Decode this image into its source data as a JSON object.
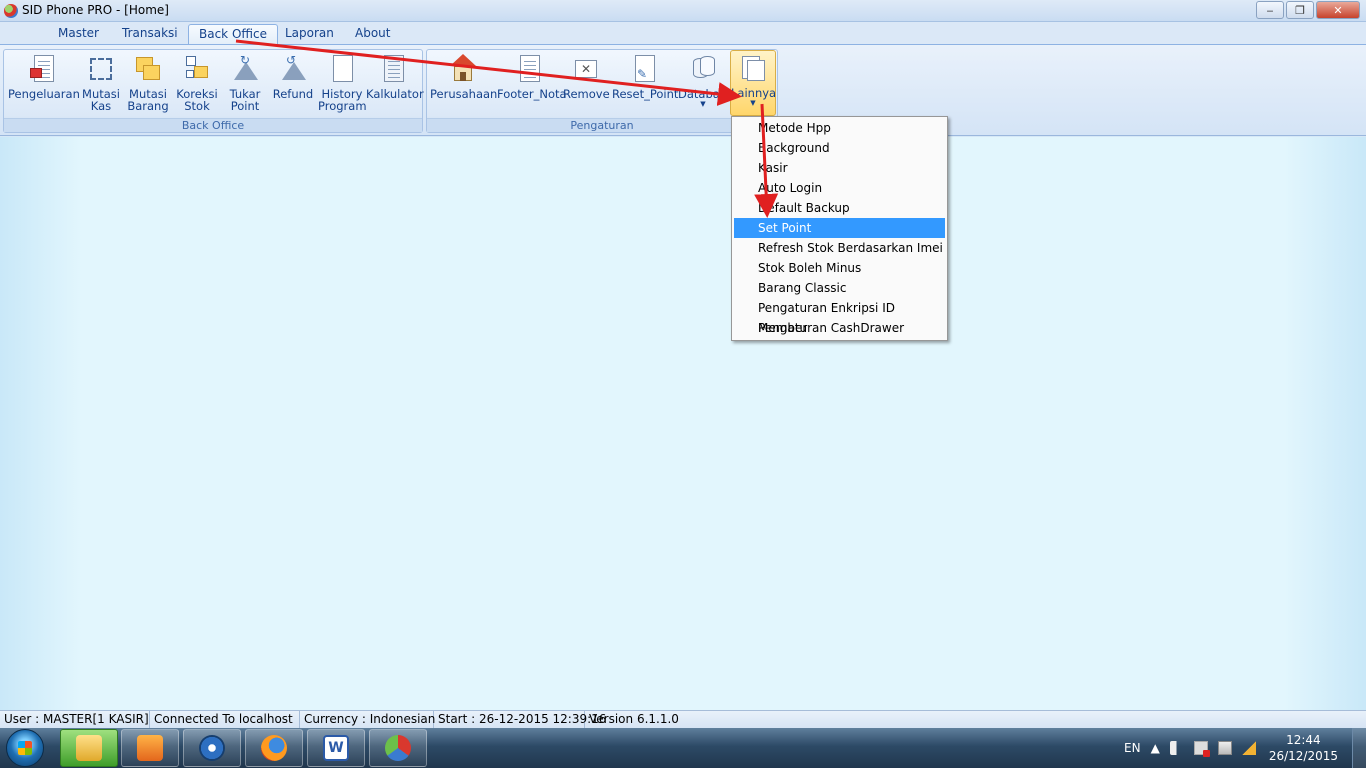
{
  "window": {
    "title": "SID Phone PRO - [Home]",
    "minimize": "‒",
    "maximize": "❐",
    "close": "✕"
  },
  "tabs": [
    "Master",
    "Transaksi",
    "Back Office",
    "Laporan",
    "About"
  ],
  "active_tab": "Back Office",
  "groups": {
    "back_office": {
      "label": "Back Office",
      "buttons": [
        {
          "line1": "Pengeluaran",
          "line2": ""
        },
        {
          "line1": "Mutasi",
          "line2": "Kas"
        },
        {
          "line1": "Mutasi",
          "line2": "Barang"
        },
        {
          "line1": "Koreksi",
          "line2": "Stok"
        },
        {
          "line1": "Tukar",
          "line2": "Point"
        },
        {
          "line1": "Refund",
          "line2": ""
        },
        {
          "line1": "History",
          "line2": "Program"
        },
        {
          "line1": "Kalkulator",
          "line2": ""
        }
      ]
    },
    "pengaturan": {
      "label": "Pengaturan",
      "buttons": [
        {
          "line1": "Perusahaan"
        },
        {
          "line1": "Footer_Nota"
        },
        {
          "line1": "Remove"
        },
        {
          "line1": "Reset_Point"
        },
        {
          "line1": "Database",
          "dropdown": "▼"
        },
        {
          "line1": "Lainnya",
          "dropdown": "▼"
        }
      ]
    }
  },
  "dropdown_menu": {
    "items": [
      "Metode Hpp",
      "Background",
      "Kasir",
      "Auto Login",
      "Default Backup",
      "Set Point",
      "Refresh Stok Berdasarkan Imei",
      "Stok Boleh Minus",
      "Barang Classic",
      "Pengaturan Enkripsi ID Member",
      "Pengaturan CashDrawer"
    ],
    "selected": "Set Point"
  },
  "status": {
    "user": "User : MASTER[1 KASIR]",
    "connection": "Connected To localhost",
    "currency": "Currency : Indonesian",
    "start": "Start  : 26-12-2015 12:39:16",
    "version": "Version 6.1.1.0"
  },
  "taskbar": {
    "language": "EN",
    "time": "12:44",
    "date": "26/12/2015"
  },
  "colors": {
    "accent": "#3399ff",
    "annotation_arrow": "#e02020",
    "ribbon_text": "#15428b"
  }
}
